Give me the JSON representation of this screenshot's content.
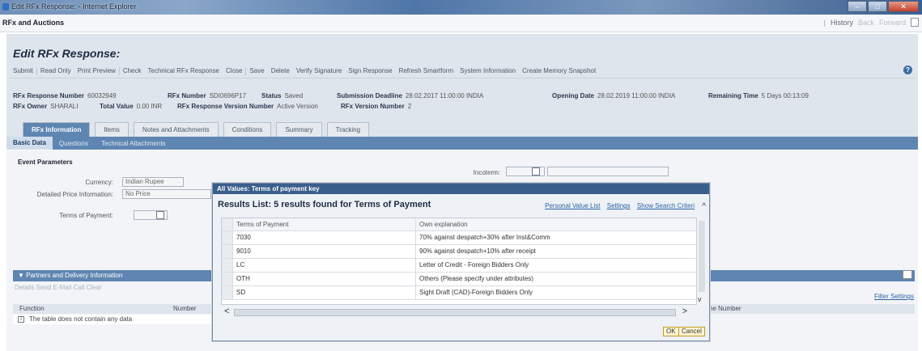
{
  "window": {
    "title": "Edit RFx Response: - Internet Explorer",
    "controls": [
      "–",
      "□",
      "✕"
    ]
  },
  "navbar": {
    "app": "RFx and Auctions",
    "history": "History",
    "back": "Back",
    "forward": "Forward"
  },
  "page": {
    "title": "Edit RFx Response:"
  },
  "toolbar": {
    "items": [
      "Submit",
      "Read Only",
      "Print Preview",
      "Check",
      "Technical RFx Response",
      "Close",
      "Save",
      "Delete",
      "Verify Signature",
      "Sign Response",
      "Refresh Smartform",
      "System Information",
      "Create Memory Snapshot"
    ]
  },
  "header_info": {
    "response_number_label": "RFx Response Number",
    "response_number": "60032949",
    "rfx_number_label": "RFx Number",
    "rfx_number": "SDI0696P17",
    "status_label": "Status",
    "status": "Saved",
    "deadline_label": "Submission Deadline",
    "deadline": "28.02.2017 11:00:00 INDIA",
    "opening_label": "Opening Date",
    "opening": "28.02.2019 11:00:00 INDIA",
    "remaining_label": "Remaining Time",
    "remaining": "5 Days 00:13:09",
    "owner_label": "RFx Owner",
    "owner": "SHARALI",
    "total_label": "Total Value",
    "total": "0.00 INR",
    "version_label": "RFx Response Version Number",
    "version": "Active Version",
    "rfx_version_label": "RFx Version Number",
    "rfx_version": "2"
  },
  "tabs": [
    "RFx Information",
    "Items",
    "Notes and Attachments",
    "Conditions",
    "Summary",
    "Tracking"
  ],
  "subtabs": [
    "Basic Data",
    "Questions",
    "Technical Attachments"
  ],
  "event": {
    "title": "Event Parameters",
    "currency_label": "Currency:",
    "currency": "Indian Rupee",
    "price_label": "Detailed Price Information:",
    "price": "No Price",
    "terms_label": "Terms of Payment:",
    "incoterm_label": "Incoterm:"
  },
  "partners": {
    "title": "▼ Partners and Delivery Information",
    "tools": "Details  Send E-Mail  Call  Clear",
    "col_function": "Function",
    "col_number": "Number",
    "col_phone": "ne Number",
    "empty": "The table does not contain any data",
    "filter": "Filter",
    "settings": "Settings"
  },
  "dialog": {
    "title": "All Values: Terms of payment key",
    "results": "Results List: 5 results found for Terms of Payment",
    "links": [
      "Personal Value List",
      "Settings",
      "Show Search Criteri"
    ],
    "headers": [
      "Terms of Payment",
      "Own explanation"
    ],
    "rows": [
      [
        "7030",
        "70% against despatch+30% after Inst&Comm"
      ],
      [
        "9010",
        "90% against despatch+10% after receipt"
      ],
      [
        "LC",
        "Letter of Credit - Foreign Bidders Only"
      ],
      [
        "OTH",
        "Others (Please specify under attributes)"
      ],
      [
        "SD",
        "Sight Draft (CAD)-Foreign Bidders Only"
      ]
    ],
    "ok": "OK",
    "cancel": "Cancel"
  }
}
